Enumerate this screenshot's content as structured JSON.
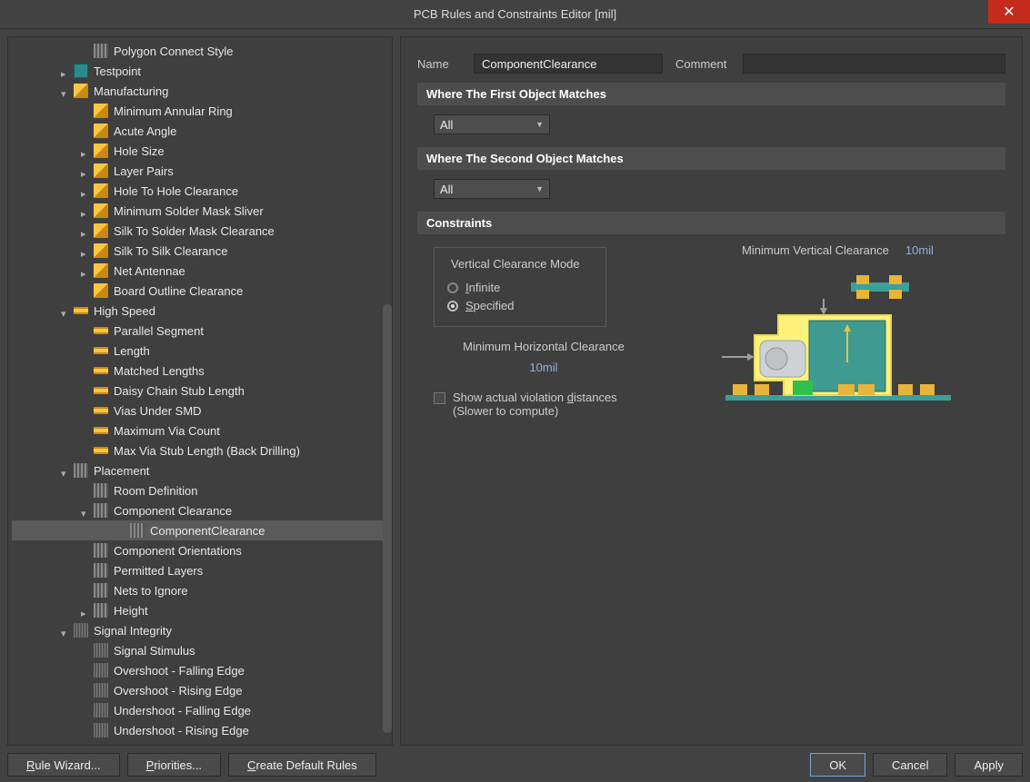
{
  "window": {
    "title": "PCB Rules and Constraints Editor [mil]"
  },
  "tree": {
    "items": [
      {
        "pad": 76,
        "caret": "none",
        "icon": "ic-rule-place",
        "label": "Polygon Connect Style"
      },
      {
        "pad": 54,
        "caret": "closed",
        "icon": "ic-rule-teal",
        "label": "Testpoint"
      },
      {
        "pad": 54,
        "caret": "open",
        "icon": "ic-rule-orange",
        "label": "Manufacturing"
      },
      {
        "pad": 76,
        "caret": "none",
        "icon": "ic-rule-orange",
        "label": "Minimum Annular Ring"
      },
      {
        "pad": 76,
        "caret": "none",
        "icon": "ic-rule-orange",
        "label": "Acute Angle"
      },
      {
        "pad": 76,
        "caret": "closed",
        "icon": "ic-rule-orange",
        "label": "Hole Size"
      },
      {
        "pad": 76,
        "caret": "closed",
        "icon": "ic-rule-orange",
        "label": "Layer Pairs"
      },
      {
        "pad": 76,
        "caret": "closed",
        "icon": "ic-rule-orange",
        "label": "Hole To Hole Clearance"
      },
      {
        "pad": 76,
        "caret": "closed",
        "icon": "ic-rule-orange",
        "label": "Minimum Solder Mask Sliver"
      },
      {
        "pad": 76,
        "caret": "closed",
        "icon": "ic-rule-orange",
        "label": "Silk To Solder Mask Clearance"
      },
      {
        "pad": 76,
        "caret": "closed",
        "icon": "ic-rule-orange",
        "label": "Silk To Silk Clearance"
      },
      {
        "pad": 76,
        "caret": "closed",
        "icon": "ic-rule-orange",
        "label": "Net Antennae"
      },
      {
        "pad": 76,
        "caret": "none",
        "icon": "ic-rule-orange",
        "label": "Board Outline Clearance"
      },
      {
        "pad": 54,
        "caret": "open",
        "icon": "ic-rule-hs",
        "label": "High Speed"
      },
      {
        "pad": 76,
        "caret": "none",
        "icon": "ic-rule-hs",
        "label": "Parallel Segment"
      },
      {
        "pad": 76,
        "caret": "none",
        "icon": "ic-rule-hs",
        "label": "Length"
      },
      {
        "pad": 76,
        "caret": "none",
        "icon": "ic-rule-hs",
        "label": "Matched Lengths"
      },
      {
        "pad": 76,
        "caret": "none",
        "icon": "ic-rule-hs",
        "label": "Daisy Chain Stub Length"
      },
      {
        "pad": 76,
        "caret": "none",
        "icon": "ic-rule-hs",
        "label": "Vias Under SMD"
      },
      {
        "pad": 76,
        "caret": "none",
        "icon": "ic-rule-hs",
        "label": "Maximum Via Count"
      },
      {
        "pad": 76,
        "caret": "none",
        "icon": "ic-rule-hs",
        "label": "Max Via Stub Length (Back Drilling)"
      },
      {
        "pad": 54,
        "caret": "open",
        "icon": "ic-rule-place",
        "label": "Placement"
      },
      {
        "pad": 76,
        "caret": "none",
        "icon": "ic-rule-place",
        "label": "Room Definition"
      },
      {
        "pad": 76,
        "caret": "open",
        "icon": "ic-rule-place",
        "label": "Component Clearance"
      },
      {
        "pad": 116,
        "caret": "none",
        "icon": "ic-rule-place",
        "label": "ComponentClearance",
        "selected": true
      },
      {
        "pad": 76,
        "caret": "none",
        "icon": "ic-rule-place",
        "label": "Component Orientations"
      },
      {
        "pad": 76,
        "caret": "none",
        "icon": "ic-rule-place",
        "label": "Permitted Layers"
      },
      {
        "pad": 76,
        "caret": "none",
        "icon": "ic-rule-place",
        "label": "Nets to Ignore"
      },
      {
        "pad": 76,
        "caret": "closed",
        "icon": "ic-rule-place",
        "label": "Height"
      },
      {
        "pad": 54,
        "caret": "open",
        "icon": "ic-rule-si",
        "label": "Signal Integrity"
      },
      {
        "pad": 76,
        "caret": "none",
        "icon": "ic-rule-si",
        "label": "Signal Stimulus"
      },
      {
        "pad": 76,
        "caret": "none",
        "icon": "ic-rule-si",
        "label": "Overshoot - Falling Edge"
      },
      {
        "pad": 76,
        "caret": "none",
        "icon": "ic-rule-si",
        "label": "Overshoot - Rising Edge"
      },
      {
        "pad": 76,
        "caret": "none",
        "icon": "ic-rule-si",
        "label": "Undershoot - Falling Edge"
      },
      {
        "pad": 76,
        "caret": "none",
        "icon": "ic-rule-si",
        "label": "Undershoot - Rising Edge"
      }
    ]
  },
  "form": {
    "name_label": "Name",
    "name_value": "ComponentClearance",
    "comment_label": "Comment",
    "comment_value": "",
    "section_first": "Where The First Object Matches",
    "first_scope": "All",
    "section_second": "Where The Second Object Matches",
    "second_scope": "All",
    "section_constraints": "Constraints",
    "vcm_legend": "Vertical Clearance Mode",
    "vcm_infinite": "Infinite",
    "vcm_specified": "Specified",
    "mhc_label": "Minimum Horizontal Clearance",
    "mhc_value": "10mil",
    "mvc_label": "Minimum Vertical Clearance",
    "mvc_value": "10mil",
    "violations_line1": "Show actual violation distances",
    "violations_line2": "(Slower to compute)"
  },
  "buttons": {
    "rule_wizard": "Rule Wizard...",
    "priorities": "Priorities...",
    "create_default": "Create Default Rules",
    "ok": "OK",
    "cancel": "Cancel",
    "apply": "Apply"
  }
}
